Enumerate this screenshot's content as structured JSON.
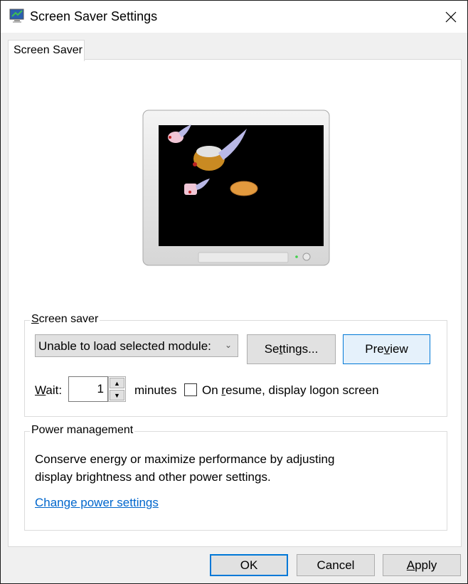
{
  "window": {
    "title": "Screen Saver Settings",
    "icon": "screen-saver-app-icon",
    "close_icon": "close-icon"
  },
  "tabs": [
    {
      "label": "Screen Saver",
      "active": true
    }
  ],
  "preview": {
    "description": "Flying toasters screen saver preview on monitor"
  },
  "screen_saver_group": {
    "label_accel": "S",
    "label_rest": "creen saver",
    "selected_module": "Unable to load selected module:",
    "settings_pre": "Se",
    "settings_accel": "t",
    "settings_post": "tings...",
    "preview_pre": "Pre",
    "preview_accel": "v",
    "preview_post": "iew",
    "wait_accel": "W",
    "wait_rest": "ait:",
    "wait_value": "1",
    "minutes_label": "minutes",
    "logon_checked": false,
    "logon_pre": "On ",
    "logon_accel": "r",
    "logon_post": "esume, display logon screen"
  },
  "power_group": {
    "label": "Power management",
    "line1": "Conserve energy or maximize performance by adjusting",
    "line2": "display brightness and other power settings.",
    "link": "Change power settings",
    "link_color": "#0066cc"
  },
  "footer": {
    "ok": "OK",
    "cancel": "Cancel",
    "apply_accel": "A",
    "apply_rest": "pply"
  },
  "colors": {
    "accent": "#0078d7"
  }
}
